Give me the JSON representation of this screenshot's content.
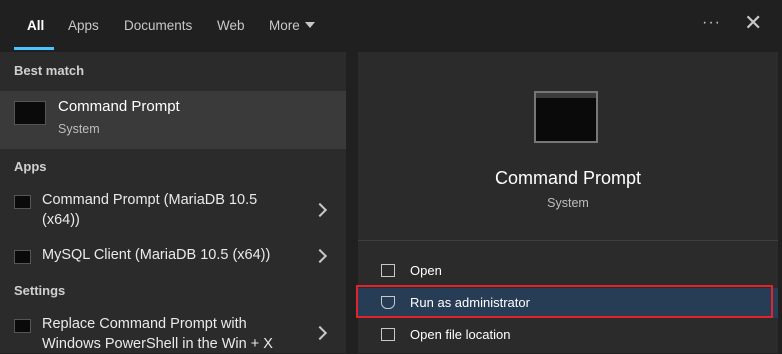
{
  "tabs": [
    {
      "label": "All"
    },
    {
      "label": "Apps"
    },
    {
      "label": "Documents"
    },
    {
      "label": "Web"
    },
    {
      "label": "More"
    }
  ],
  "header": {
    "more_icon": "ellipsis-icon",
    "close_icon": "close-icon"
  },
  "left": {
    "best_match_heading": "Best match",
    "best": {
      "title": "Command Prompt",
      "subtitle": "System"
    },
    "apps_heading": "Apps",
    "apps": [
      {
        "label": "Command Prompt (MariaDB 10.5 (x64))"
      },
      {
        "label": "MySQL Client (MariaDB 10.5 (x64))"
      }
    ],
    "settings_heading": "Settings",
    "settings": [
      {
        "label": "Replace Command Prompt with Windows PowerShell in the Win + X"
      }
    ]
  },
  "right": {
    "title": "Command Prompt",
    "subtitle": "System",
    "actions": [
      {
        "label": "Open",
        "icon": "open-icon"
      },
      {
        "label": "Run as administrator",
        "icon": "shield-icon"
      },
      {
        "label": "Open file location",
        "icon": "folder-icon"
      }
    ]
  },
  "colors": {
    "accent": "#4cc2ff",
    "highlight_border": "#e1232b",
    "selected": "#273d55"
  }
}
